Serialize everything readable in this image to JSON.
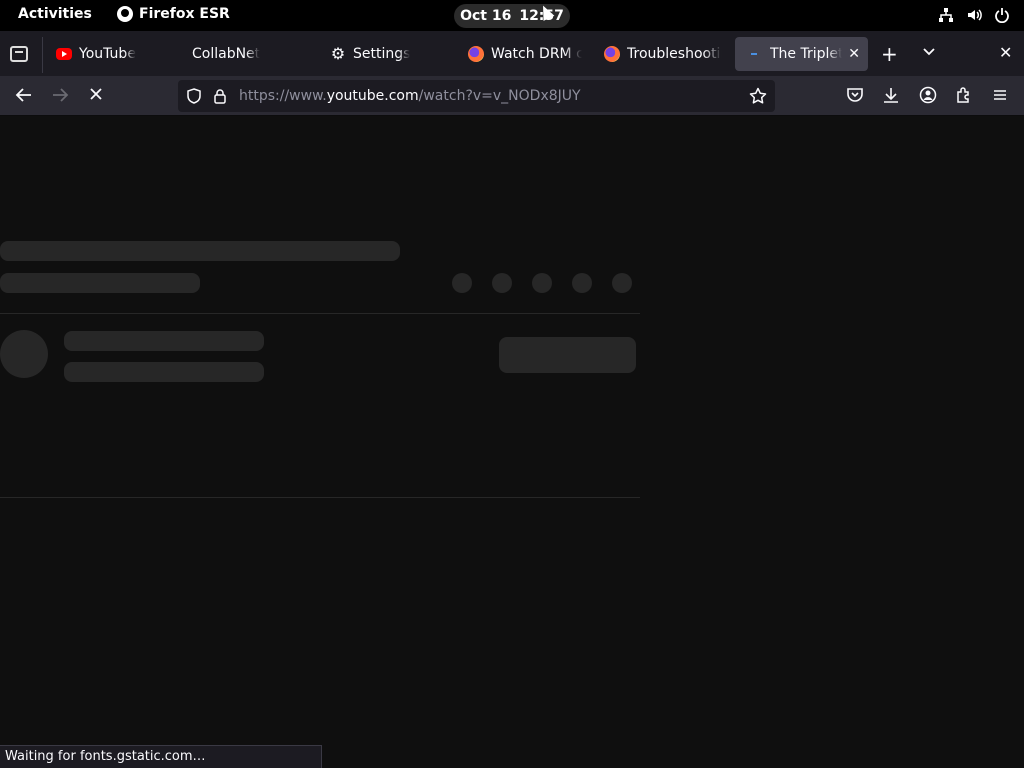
{
  "topbar": {
    "activities": "Activities",
    "app_name": "Firefox ESR",
    "date": "Oct 16",
    "time": "12:57",
    "tray_icons": [
      "network-icon",
      "volume-icon",
      "power-icon"
    ]
  },
  "tabs": [
    {
      "label": "YouTube",
      "favicon": "youtube-icon",
      "active": false
    },
    {
      "label": "CollabNet",
      "favicon": "none",
      "active": false
    },
    {
      "label": "Settings",
      "favicon": "gear-icon",
      "active": false
    },
    {
      "label": "Watch DRM content",
      "favicon": "firefox-icon",
      "active": false
    },
    {
      "label": "Troubleshooting",
      "favicon": "firefox-icon",
      "active": false
    },
    {
      "label": "The Triplets",
      "favicon": "loading-icon",
      "active": true
    }
  ],
  "navbar": {
    "url_prefix": "https://www.",
    "url_host": "youtube.com",
    "url_path": "/watch?v=v_NODx8JUY"
  },
  "status_text": "Waiting for fonts.gstatic.com…",
  "colors": {
    "page_bg": "#0f0f0f",
    "skeleton": "#272727",
    "chrome_dark": "#1c1b22",
    "toolbar": "#2b2a33",
    "active_tab": "#42414d"
  }
}
